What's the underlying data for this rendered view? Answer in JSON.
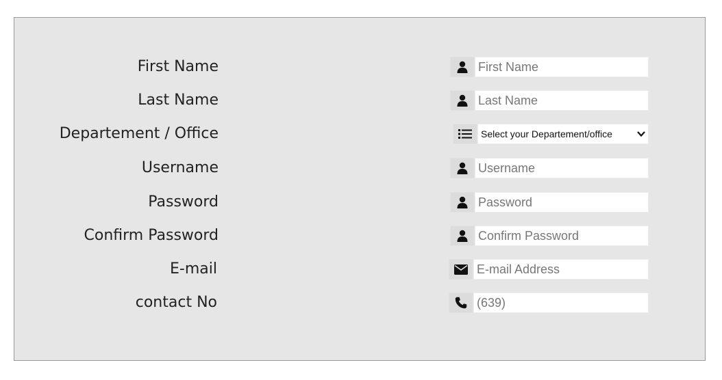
{
  "form": {
    "rows": [
      {
        "label": "First Name",
        "placeholder": "First Name",
        "value": "",
        "icon": "user-icon"
      },
      {
        "label": "Last Name",
        "placeholder": "Last Name",
        "value": "",
        "icon": "user-icon"
      },
      {
        "label": "Departement / Office",
        "select_value": "Select your Departement/office",
        "icon": "list-icon"
      },
      {
        "label": "Username",
        "placeholder": "Username",
        "value": "",
        "icon": "user-icon"
      },
      {
        "label": "Password",
        "placeholder": "Password",
        "value": "",
        "icon": "user-icon"
      },
      {
        "label": "Confirm Password",
        "placeholder": "Confirm Password",
        "value": "",
        "icon": "user-icon"
      },
      {
        "label": "E-mail",
        "placeholder": "E-mail Address",
        "value": "",
        "icon": "envelope-icon"
      },
      {
        "label": "contact No",
        "placeholder": "(639)",
        "value": "",
        "icon": "phone-icon"
      }
    ]
  }
}
